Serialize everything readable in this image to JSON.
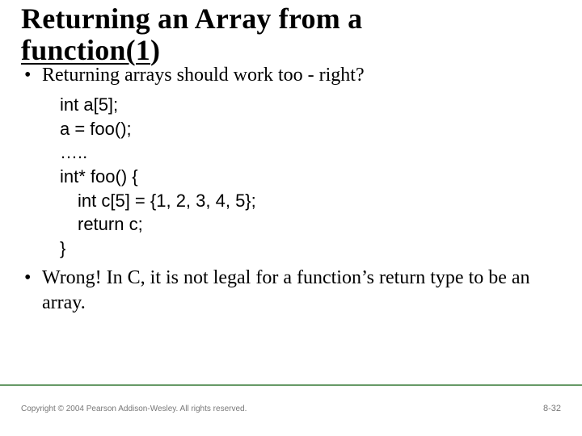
{
  "title": {
    "line1": "Returning an Array from a",
    "line2_prefix": "function(1",
    "line2_suffix": ")"
  },
  "bullets": {
    "b1": "Returning arrays should work too - right?",
    "b2": "Wrong! In C, it is not legal for a function’s return type to be an array."
  },
  "code": {
    "l1": "int a[5];",
    "l2": "a = foo();",
    "l3": "…..",
    "l4": "int* foo() {",
    "l5": "int c[5] = {1, 2, 3, 4, 5};",
    "l6": "return c;",
    "l7": "}"
  },
  "footer": {
    "copyright": "Copyright © 2004 Pearson Addison-Wesley. All rights reserved.",
    "pagenum": "8-32"
  }
}
